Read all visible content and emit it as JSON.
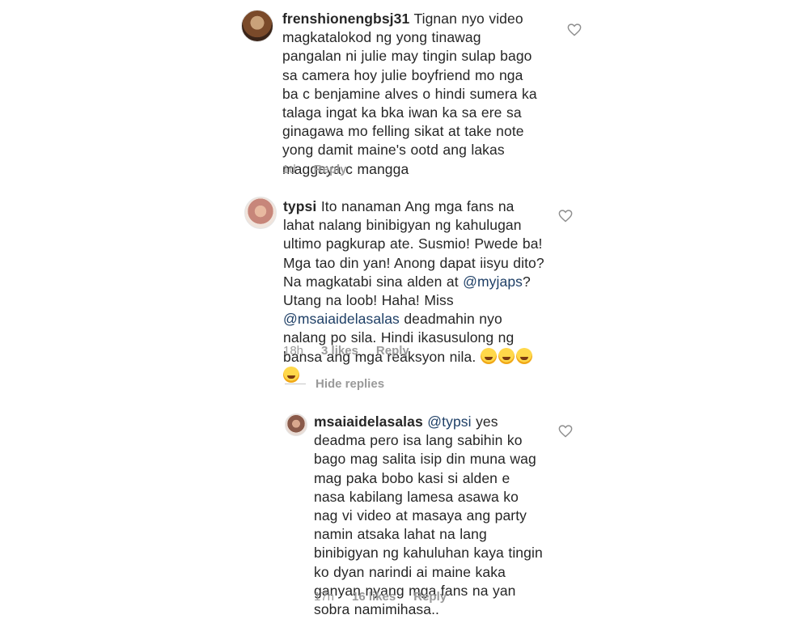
{
  "comments": [
    {
      "username": "frenshionengbsj31",
      "text": " Tignan nyo video magkatalokod ng yong tinawag pangalan ni julie may tingin sulap bago sa camera hoy julie boyfriend mo nga ba c benjamine alves o hindi sumera ka talaga ingat ka bka iwan ka sa ere sa ginagawa mo felling sikat at take note yong damit maine's ootd ang lakas maggaya c mangga",
      "time": "1d",
      "reply_label": "Reply"
    },
    {
      "username": "typsi",
      "text_a": " Ito nanaman Ang mga fans na lahat nalang binibigyan ng kahulugan ultimo pagkurap ate. Susmio! Pwede ba! Mga tao din yan! Anong dapat iisyu dito? Na magkatabi sina alden at ",
      "mention_a": "@myjaps",
      "text_b": "? Utang na loob! Haha! Miss ",
      "mention_b": "@msaiaidelasalas",
      "text_c": " deadmahin nyo nalang po sila. Hindi ikasusulong ng bansa ang mga reaksyon nila. ",
      "time": "18h",
      "likes": "3 likes",
      "reply_label": "Reply"
    }
  ],
  "hide_replies_label": "Hide replies",
  "reply": {
    "username": "msaiaidelasalas",
    "mention": "@typsi",
    "text": " yes deadma pero isa lang sabihin ko bago mag salita isip din muna wag mag paka bobo kasi si alden e nasa kabilang lamesa asawa ko nag vi video at masaya ang party namin atsaka lahat na lang binibigyan ng kahuluhan kaya tingin ko dyan narindi ai maine kaka ganyan nyang mga fans na yan sobra namimihasa..",
    "time": "17h",
    "likes": "16 likes",
    "reply_label": "Reply"
  }
}
